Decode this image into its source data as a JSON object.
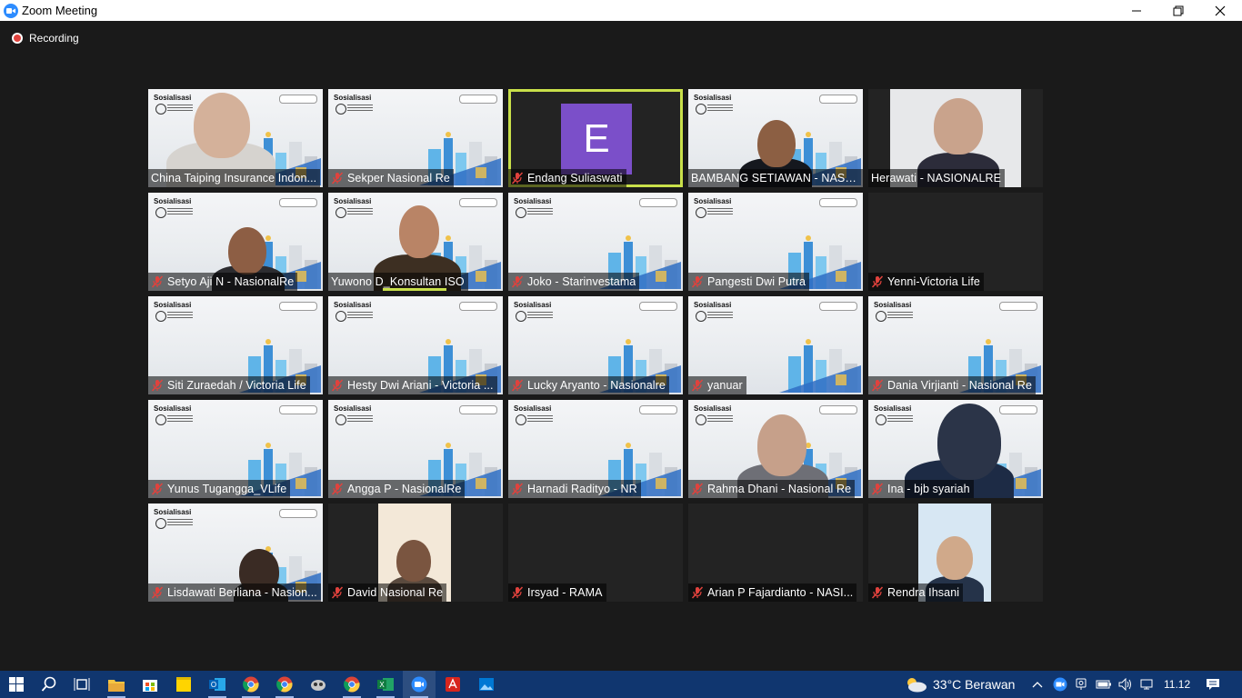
{
  "window": {
    "title": "Zoom Meeting",
    "controls": [
      "minimize-icon",
      "restore-icon",
      "close-icon"
    ]
  },
  "recording": {
    "label": "Recording"
  },
  "participants": [
    {
      "name": "China Taiping Insurance Indon...",
      "muted": false,
      "video": "slide-with-person"
    },
    {
      "name": "Sekper Nasional Re",
      "muted": true,
      "video": "slide"
    },
    {
      "name": "Endang Suliaswati",
      "muted": true,
      "video": "avatar",
      "initial": "E",
      "active_speaker": true
    },
    {
      "name": "BAMBANG SETIAWAN - NASIO...",
      "muted": false,
      "video": "slide-with-person"
    },
    {
      "name": "Herawati - NASIONALRE",
      "muted": false,
      "video": "camera"
    },
    {
      "name": "Setyo Aji N - NasionalRe",
      "muted": true,
      "video": "slide-with-person"
    },
    {
      "name": "Yuwono D_Konsultan ISO",
      "muted": false,
      "video": "slide-with-person",
      "speaking": true
    },
    {
      "name": "Joko - Starinvestama",
      "muted": true,
      "video": "slide"
    },
    {
      "name": "Pangesti Dwi Putra",
      "muted": true,
      "video": "slide"
    },
    {
      "name": "Yenni-Victoria Life",
      "muted": true,
      "video": "off"
    },
    {
      "name": "Siti Zuraedah / Victoria Life",
      "muted": true,
      "video": "slide"
    },
    {
      "name": "Hesty Dwi Ariani - Victoria ...",
      "muted": true,
      "video": "slide"
    },
    {
      "name": "Lucky Aryanto - Nasionalre",
      "muted": true,
      "video": "slide"
    },
    {
      "name": "yanuar",
      "muted": true,
      "video": "slide"
    },
    {
      "name": "Dania Virjianti - Nasional Re",
      "muted": true,
      "video": "slide"
    },
    {
      "name": "Yunus Tugangga_VLife",
      "muted": true,
      "video": "slide"
    },
    {
      "name": "Angga P - NasionalRe",
      "muted": true,
      "video": "slide"
    },
    {
      "name": "Harnadi Radityo - NR",
      "muted": true,
      "video": "slide"
    },
    {
      "name": "Rahma Dhani - Nasional Re",
      "muted": true,
      "video": "slide-with-person"
    },
    {
      "name": "Ina - bjb syariah",
      "muted": true,
      "video": "slide-with-person"
    },
    {
      "name": "Lisdawati Berliana - Nasion...",
      "muted": true,
      "video": "slide-with-person"
    },
    {
      "name": "David Nasional Re",
      "muted": true,
      "video": "camera"
    },
    {
      "name": "Irsyad - RAMA",
      "muted": true,
      "video": "off"
    },
    {
      "name": "Arian P Fajardianto - NASI...",
      "muted": true,
      "video": "off"
    },
    {
      "name": "Rendra Ihsani",
      "muted": true,
      "video": "camera"
    }
  ],
  "slide": {
    "title": "Sosialisasi"
  },
  "taskbar": {
    "apps": [
      "windows-start-icon",
      "search-icon",
      "task-view-icon",
      "file-explorer-icon",
      "store-icon",
      "sticky-notes-icon",
      "outlook-icon",
      "chrome-icon",
      "chrome-icon",
      "app-icon",
      "chrome-icon",
      "excel-icon",
      "zoom-icon",
      "acrobat-icon",
      "photos-icon"
    ],
    "weather": "33°C  Berawan",
    "time": "11.12"
  }
}
